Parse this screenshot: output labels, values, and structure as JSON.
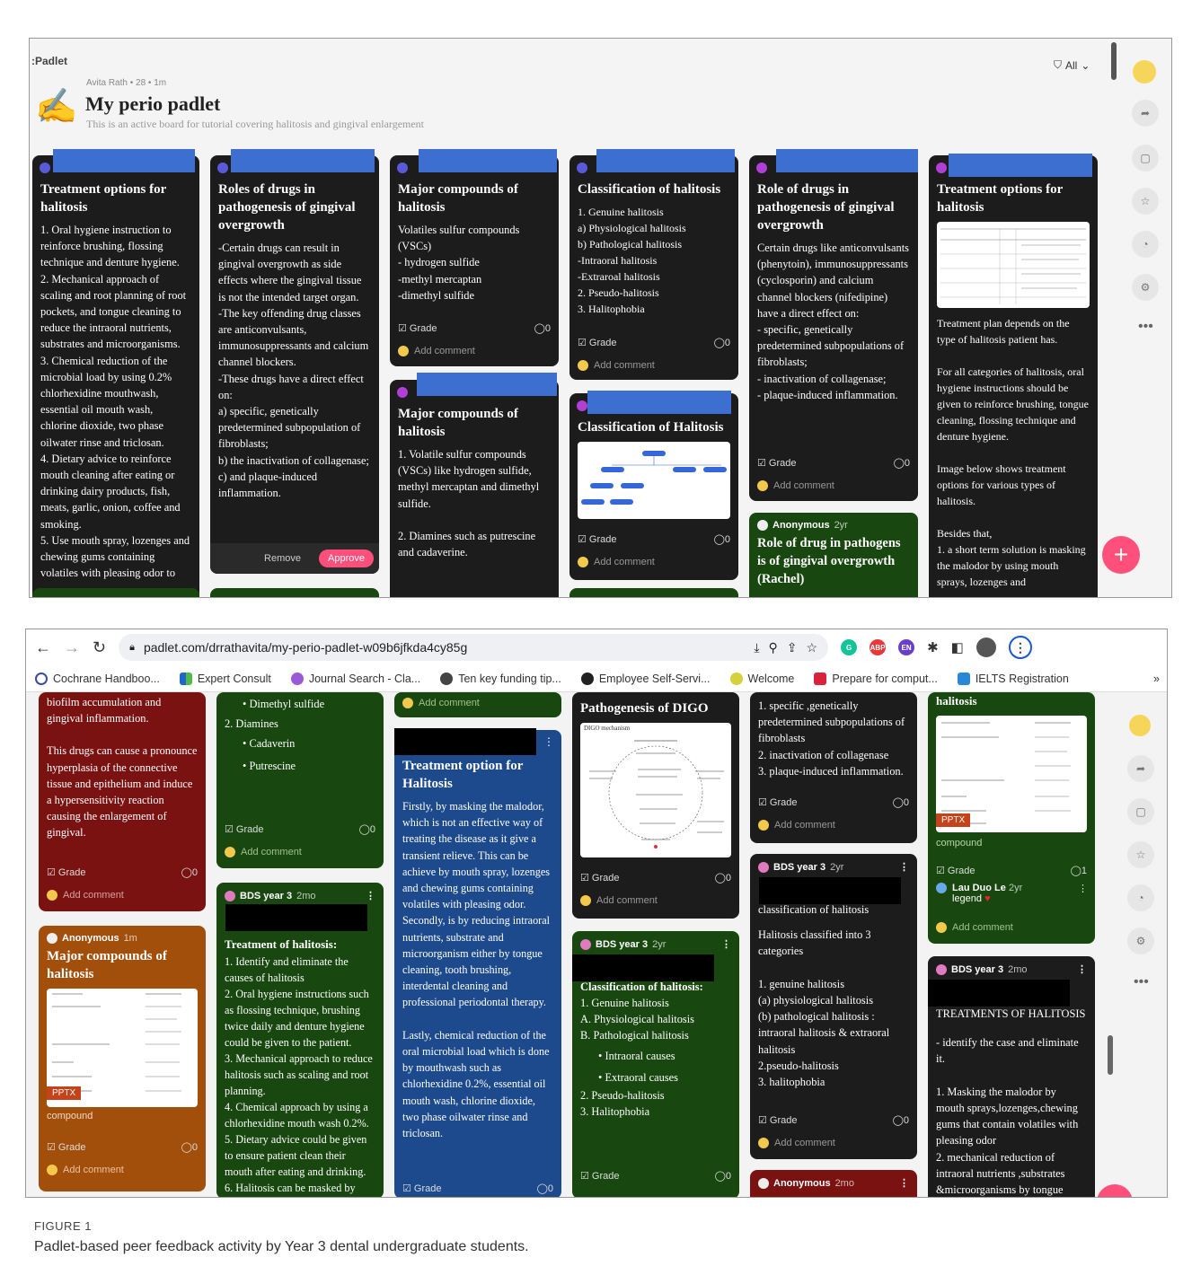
{
  "panel1": {
    "brand": ":Padlet",
    "filter_label": "All",
    "author_line": "Avita Rath • 28 • 1m",
    "board_title": "My perio padlet",
    "board_desc": "This is an active board for tutorial covering halitosis and gingival enlargement",
    "common": {
      "grade": "Grade",
      "comment_count": "0",
      "add_comment": "Add comment"
    },
    "cards": {
      "c1": {
        "title": "Treatment options for halitosis",
        "body": "1. Oral hygiene instruction to reinforce brushing, flossing technique and denture hygiene.\n2. Mechanical approach of scaling and root planning of root pockets, and tongue cleaning to reduce the intraoral nutrients, substrates and microorganisms.\n3. Chemical reduction of the microbial load by using 0.2% chlorhexidine mouthwash, essential oil mouth wash, chlorine dioxide, two phase oilwater rinse and triclosan.\n4. Dietary advice to reinforce mouth cleaning after eating or drinking dairy products, fish, meats, garlic, onion, coffee and smoking.\n5. Use mouth spray, lozenges and chewing gums containing volatiles with pleasing odor to"
      },
      "c2": {
        "title": "Roles of drugs in pathogenesis of gingival overgrowth",
        "body": "-Certain drugs can result in gingival overgrowth as side effects where the gingival tissue is not the intended target organ.\n -The key offending drug classes are anticonvulsants, immunosuppressants and calcium channel blockers.\n-These drugs have a direct effect on:\n a) specific, genetically predetermined subpopulation of fibroblasts;\nb) the inactivation of collagenase;\nc) and plaque-induced inflammation.",
        "remove": "Remove",
        "approve": "Approve"
      },
      "c3a": {
        "title": "Major compounds of halitosis",
        "body": "Volatiles sulfur compounds (VSCs)\n- hydrogen sulfide\n-methyl mercaptan\n-dimethyl sulfide"
      },
      "c3b": {
        "title": "Major compounds of halitosis",
        "body": "1. Volatile sulfur compounds (VSCs) like hydrogen sulfide, methyl mercaptan and dimethyl sulfide.\n\n2. Diamines such as putrescine and cadaverine."
      },
      "c4a": {
        "title": "Classification of halitosis",
        "body": "1. Genuine halitosis\n a) Physiological halitosis\n b) Pathological halitosis\n   -Intraoral halitosis\n   -Extraroal halitosis\n2. Pseudo-halitosis\n3. Halitophobia"
      },
      "c4b": {
        "title": "Classification of Halitosis"
      },
      "c5a": {
        "title": "Role of drugs in pathogenesis of gingival overgrowth",
        "body": "Certain drugs like anticonvulsants (phenytoin), immunosuppressants (cyclosporin) and calcium channel blockers (nifedipine) have a direct effect on:\n- specific, genetically predetermined subpopulations of fibroblasts;\n- inactivation of collagenase;\n- plaque-induced inflammation."
      },
      "c5b": {
        "author": "Anonymous",
        "age": "2yr",
        "title": "Role of drug in pathogens is of gingival overgrowth (Rachel)"
      },
      "c6": {
        "title": "Treatment options for halitosis",
        "body": "Treatment plan depends on the type of halitosis patient has.\n\nFor all categories of halitosis, oral hygiene instructions should be given to reinforce brushing, tongue cleaning, flossing technique and denture hygiene.\n\nImage below shows treatment options for various types of halitosis.\n\nBesides that,\n1. a short term solution is masking the malodor by using mouth sprays, lozenges and"
      }
    }
  },
  "panel2": {
    "url": "padlet.com/drrathavita/my-perio-padlet-w09b6jfkda4cy85g",
    "bookmarks": [
      "Cochrane Handboo...",
      "Expert Consult",
      "Journal Search - Cla...",
      "Ten key funding tip...",
      "Employee Self-Servi...",
      "Welcome",
      "Prepare for comput...",
      "IELTS Registration"
    ],
    "bookmarks_more": "»",
    "common": {
      "grade": "Grade",
      "comment_count": "0",
      "add_comment": "Add comment",
      "pptx": "PPTX",
      "compound": "compound"
    },
    "cards": {
      "r1": {
        "top_text": "biofilm accumulation and gingival inflammation.",
        "body": "This drugs can cause a pronounce hyperplasia of the connective tissue and epithelium and induce a hypersensitivity reaction causing the enlargement of gingival."
      },
      "o1": {
        "author": "Anonymous",
        "age": "1m",
        "title": "Major compounds of halitosis"
      },
      "g1": {
        "items": [
          "Dimethyl sulfide",
          "2. Diamines",
          "Cadaverin",
          "Putrescine"
        ]
      },
      "g2": {
        "author": "BDS year 3",
        "age": "2mo",
        "title": "Treatment of halitosis:",
        "body": "1. Identify and eliminate the causes of halitosis\n2. Oral hygiene instructions such as flossing technique, brushing twice daily and denture hygiene could be given to the patient.\n3. Mechanical approach to reduce halitosis such as scaling and root planning.\n4. Chemical approach by using a chlorhexidine mouth wash 0.2%.\n5. Dietary advice could be given to ensure patient clean their mouth after eating and drinking.\n6. Halitosis can be masked by"
      },
      "b1": {
        "title": "Treatment option for Halitosis",
        "body": "Firstly, by masking the malodor, which is not an effective way of treating the disease as it give a transient relieve. This can be achieve by mouth spray, lozenges and chewing gums containing volatiles with pleasing odor.\n Secondly, is by reducing intraoral nutrients, substrate and microorganism either by tongue cleaning, tooth brushing, interdental cleaning and professional periodontal therapy.\n\nLastly, chemical reduction of the oral microbial load which is done by mouthwash such as chlorhexidine 0.2%, essential oil mouth wash, chlorine dioxide, two phase oilwater rinse and triclosan."
      },
      "d1": {
        "title": "Pathogenesis of DIGO",
        "diagram_head": "DIGO mechanism"
      },
      "g3": {
        "author": "BDS year 3",
        "age": "2yr",
        "title": "Classification of halitosis:",
        "items": [
          "1. Genuine halitosis",
          "A. Physiological halitosis",
          "B. Pathological halitosis",
          "Intraoral causes",
          "Extraoral causes",
          "2. Pseudo-halitosis",
          "3. Halitophobia"
        ]
      },
      "d2": {
        "body": "1. specific ,genetically predetermined subpopulations of fibroblasts\n2. inactivation of collagenase\n3. plaque-induced inflammation."
      },
      "d3": {
        "author": "BDS year 3",
        "age": "2yr",
        "sub": "classification of halitosis",
        "body": "Halitosis classified into 3 categories\n\n1. genuine halitosis\n(a) physiological halitosis\n(b) pathological halitosis : intraoral halitosis & extraoral halitosis\n2.pseudo-halitosis\n3. halitophobia"
      },
      "red2": {
        "author": "Anonymous",
        "age": "2mo"
      },
      "g4": {
        "top_text": "halitosis",
        "comment_count": "1",
        "commenter": "Lau Duo Le",
        "commenter_age": "2yr",
        "comment_text": "legend"
      },
      "d4": {
        "author": "BDS year 3",
        "age": "2mo",
        "title": "TREATMENTS OF HALITOSIS",
        "body": "- identify the case and eliminate it.\n\n1. Masking the malodor by mouth sprays,lozenges,chewing gums that contain volatiles with pleasing odor\n2. mechanical reduction of intraoral nutrients ,substrates &microorganisms by tongue"
      }
    }
  },
  "caption": {
    "label": "FIGURE 1",
    "text": "Padlet-based peer feedback activity by Year 3 dental undergraduate students."
  },
  "colors": {
    "card_dark": "#1c1c1c",
    "card_green": "#18480f",
    "card_red": "#7a1212",
    "card_orange": "#a34f0c",
    "card_blue": "#1c4a8c",
    "approve": "#ff4f7a",
    "fab": "#ff4f7a"
  }
}
